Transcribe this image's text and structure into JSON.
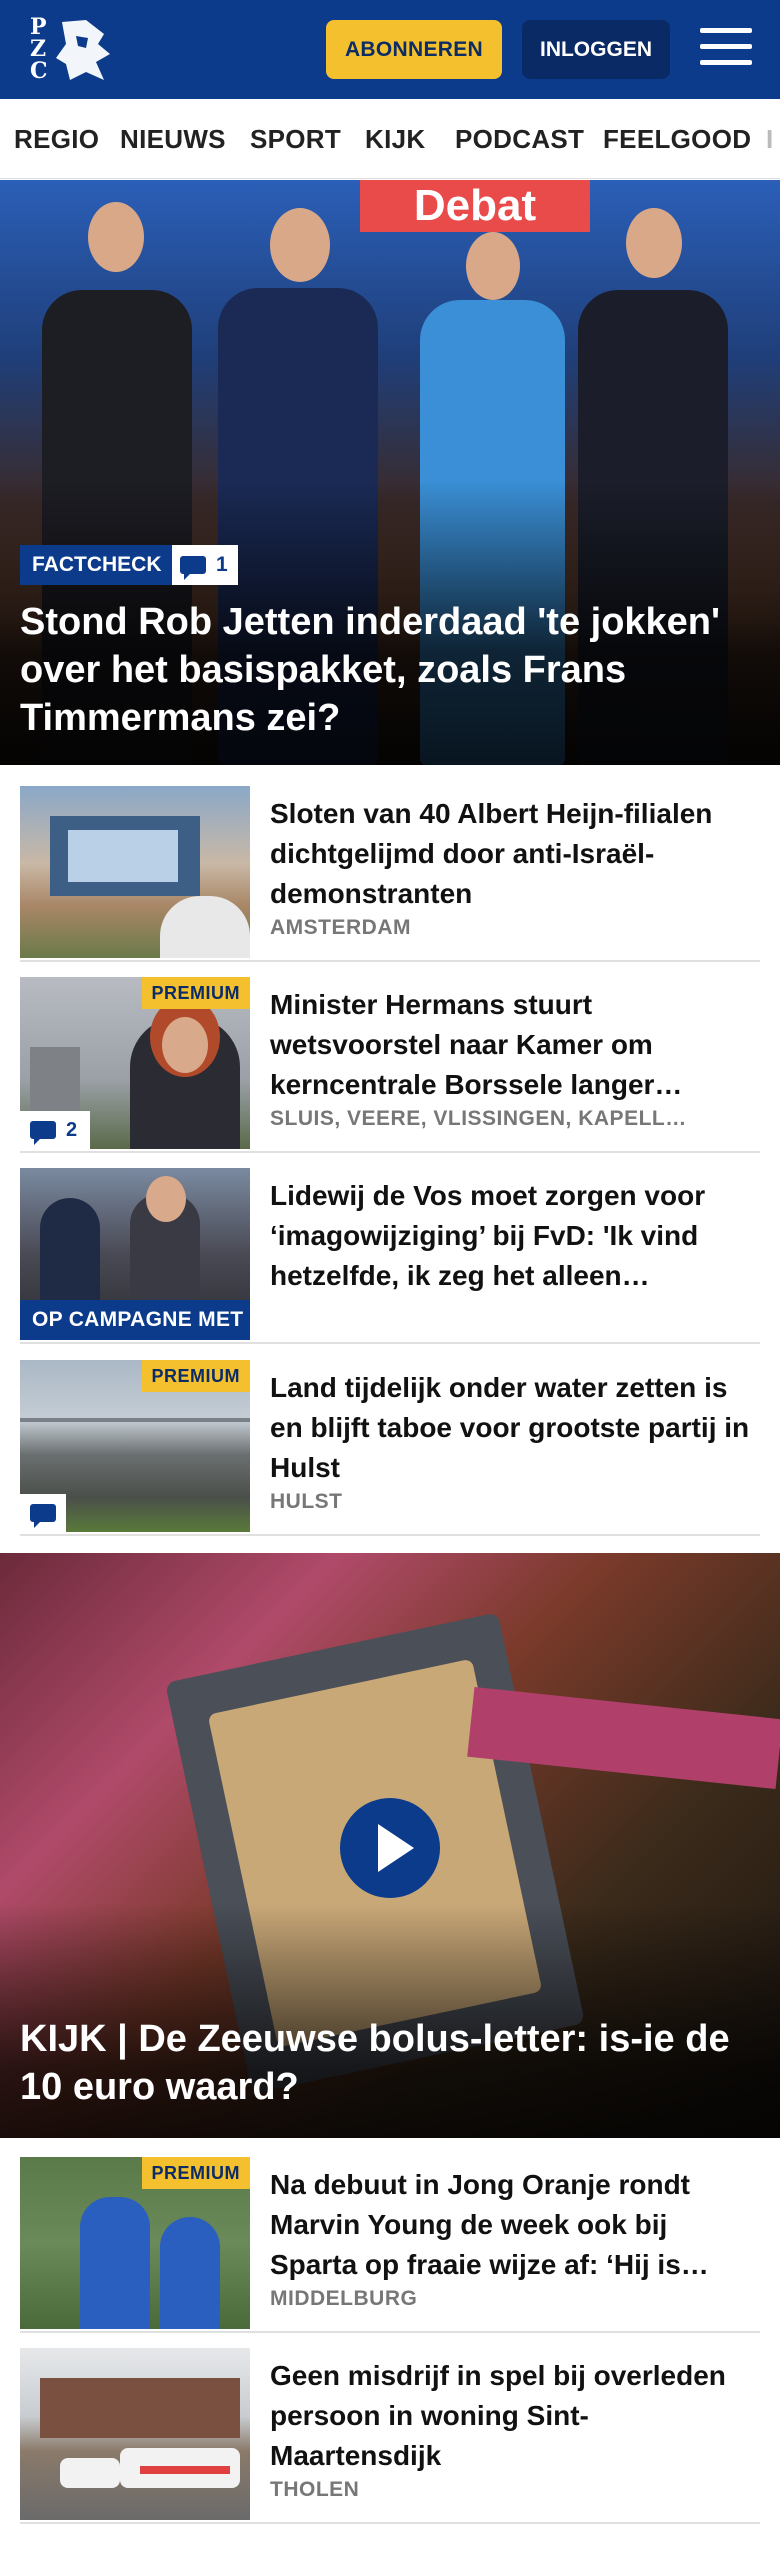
{
  "header": {
    "logo_text": "PZC",
    "subscribe_label": "ABONNEREN",
    "login_label": "INLOGGEN",
    "brand_color": "#0c3b8c",
    "accent_color": "#f5c02e"
  },
  "nav": {
    "items": [
      "REGIO",
      "NIEUWS",
      "SPORT",
      "KIJK",
      "PODCAST",
      "FEELGOOD",
      "I"
    ]
  },
  "hero": {
    "banner_text": "Debat",
    "tag": "FACTCHECK",
    "comment_count": "1",
    "title": "Stond Rob Jetten inderdaad 'te jokken' over het basispakket, zoals Frans Timmermans zei?"
  },
  "articles": [
    {
      "title": "Sloten van 40 Albert Heijn-filialen dichtgelijmd door anti-Israël-demonstranten",
      "location": "AMSTERDAM"
    },
    {
      "premium": "PREMIUM",
      "comment_count": "2",
      "title": "Minister Hermans stuurt wetsvoorstel naar Kamer om kerncentrale Borssele langer…",
      "location": "SLUIS, VEERE, VLISSINGEN, KAPELL…"
    },
    {
      "thumb_label": "OP CAMPAGNE MET",
      "title": "Lidewij de Vos moet zorgen voor ‘imagowijziging’ bij FvD: 'Ik vind hetzelfde, ik zeg het alleen…"
    },
    {
      "premium": "PREMIUM",
      "title": "Land tijdelijk onder water zetten is en blijft taboe voor grootste partij in Hulst",
      "location": "HULST"
    }
  ],
  "video": {
    "title": "KIJK | De Zeeuwse bolus-letter: is-ie de 10 euro waard?"
  },
  "articles_2": [
    {
      "premium": "PREMIUM",
      "title": "Na debuut in Jong Oranje rondt Marvin Young de week ook bij Sparta op fraaie wijze af: ‘Hij is…",
      "location": "MIDDELBURG"
    },
    {
      "title": "Geen misdrijf in spel bij overleden persoon in woning Sint-Maartensdijk",
      "location": "THOLEN"
    }
  ]
}
